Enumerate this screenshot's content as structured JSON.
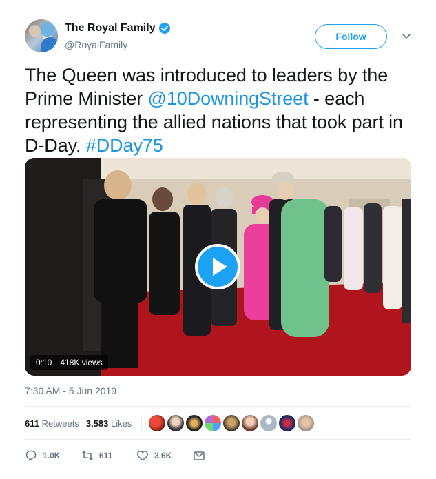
{
  "tweet": {
    "author": {
      "display_name": "The Royal Family",
      "handle": "@RoyalFamily",
      "verified": true
    },
    "follow_label": "Follow",
    "text": {
      "part1": "The Queen was introduced to leaders by the Prime Minister ",
      "mention": "@10DowningStreet",
      "part2": " - each representing the allied nations that took part in D-Day. ",
      "hashtag": "#DDay75"
    },
    "video": {
      "duration": "0:10",
      "views": "418K views"
    },
    "timestamp": "7:30 AM - 5 Jun 2019",
    "stats": {
      "retweets_count": "611",
      "retweets_label": "Retweets",
      "likes_count": "3,583",
      "likes_label": "Likes"
    },
    "actions": {
      "reply_count": "1.0K",
      "retweet_count": "611",
      "like_count": "3.6K"
    }
  },
  "colors": {
    "accent": "#1da1f2",
    "link": "#1b95e0",
    "secondary_text": "#657786"
  }
}
